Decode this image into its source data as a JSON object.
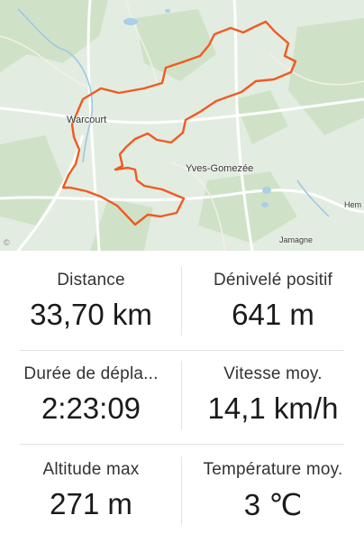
{
  "map": {
    "places": {
      "town1": "Warcourt",
      "town2": "Yves-Gomezée",
      "town3": "Hem",
      "town4": "Jamagne"
    },
    "route_color": "#f05a22",
    "background_color": "#e3ece0"
  },
  "stats": [
    {
      "label": "Distance",
      "value": "33,70 km"
    },
    {
      "label": "Dénivelé positif",
      "value": "641 m"
    },
    {
      "label": "Durée de dépla...",
      "value": "2:23:09"
    },
    {
      "label": "Vitesse moy.",
      "value": "14,1 km/h"
    },
    {
      "label": "Altitude max",
      "value": "271 m"
    },
    {
      "label": "Température moy.",
      "value": "3  ℃"
    }
  ]
}
